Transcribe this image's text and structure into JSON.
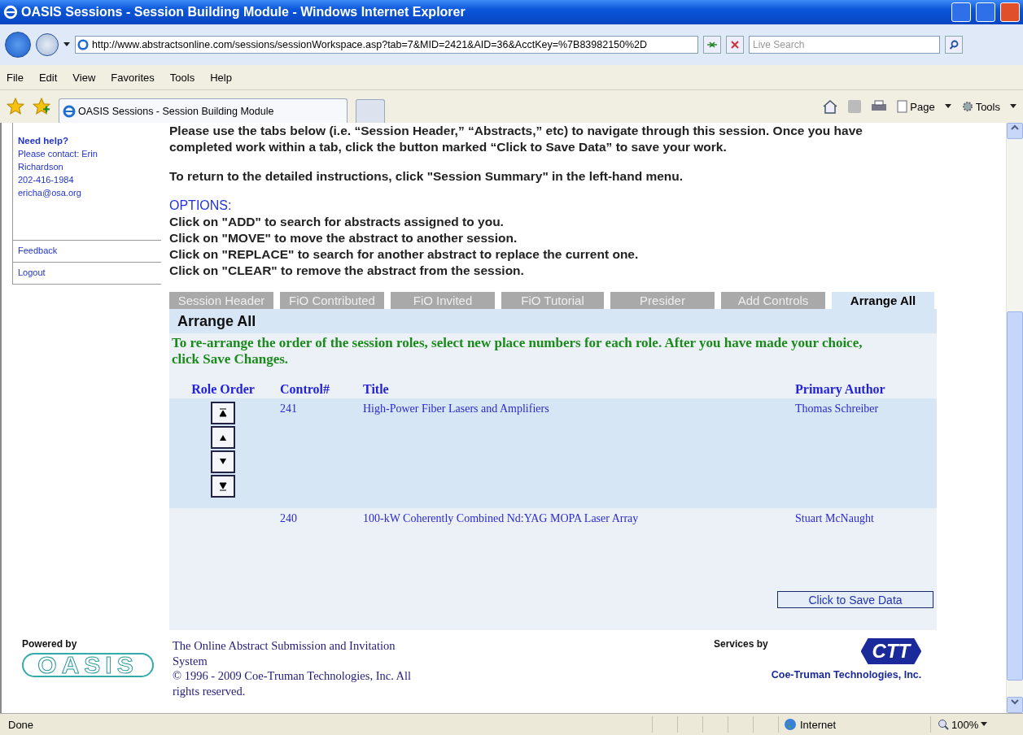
{
  "window": {
    "title": "OASIS Sessions - Session Building Module - Windows Internet Explorer"
  },
  "address_bar": {
    "url": "http://www.abstractsonline.com/sessions/sessionWorkspace.asp?tab=7&MID=2421&AID=36&AcctKey=%7B83982150%2D"
  },
  "search": {
    "placeholder": "Live Search"
  },
  "menu": [
    "File",
    "Edit",
    "View",
    "Favorites",
    "Tools",
    "Help"
  ],
  "browser_tabs": [
    {
      "label": "OASIS Sessions - Session Building Module",
      "selected": true
    }
  ],
  "command_bar": [
    "Page",
    "Tools"
  ],
  "sidebar": {
    "help_title": "Need help?",
    "contact_lines": [
      "Please contact: Erin",
      "Richardson",
      "202-416-1984",
      "ericha@osa.org"
    ],
    "links": [
      "Feedback",
      "Logout"
    ]
  },
  "intro": [
    "Please use the tabs below (i.e. “Session Header,” “Abstracts,” etc) to navigate through this session. Once you have completed work within a tab, click the button marked “Click to Save Data” to save your work.",
    "To return to the detailed instructions, click \"Session Summary\" in the left-hand menu."
  ],
  "options": {
    "heading": "OPTIONS:",
    "lines": [
      "Click on \"ADD\" to search for abstracts assigned to you.",
      "Click on \"MOVE\" to move the abstract to another session.",
      "Click on \"REPLACE\" to search for another abstract to replace the current one.",
      "Click on \"CLEAR\" to remove the abstract from the session."
    ]
  },
  "tabs": [
    {
      "label": "Session Header",
      "selected": false
    },
    {
      "label": "FiO Contributed",
      "selected": false
    },
    {
      "label": "FiO Invited",
      "selected": false
    },
    {
      "label": "FiO Tutorial",
      "selected": false
    },
    {
      "label": "Presider",
      "selected": false
    },
    {
      "label": "Add Controls",
      "selected": false
    },
    {
      "label": "Arrange All",
      "selected": true
    }
  ],
  "panel": {
    "title": "Arrange All",
    "instructions": "To re-arrange the order of the session roles, select new place numbers for each role. After you have made your choice, click Save Changes.",
    "columns": [
      "Role Order",
      "Control#",
      "Title",
      "Primary Author"
    ],
    "rows": [
      {
        "control": "241",
        "title": "High-Power Fiber Lasers and Amplifiers",
        "author": "Thomas Schreiber",
        "selected": true
      },
      {
        "control": "240",
        "title": "100-kW Coherently Combined Nd:YAG MOPA Laser Array",
        "author": "Stuart McNaught",
        "selected": false
      }
    ],
    "save_button": "Click to Save Data"
  },
  "footer": {
    "powered_by": "Powered by",
    "logo": "OASIS",
    "description": "The Online Abstract Submission and Invitation System",
    "copyright": "© 1996 - 2009 Coe-Truman Technologies, Inc. All rights reserved.",
    "services_by": "Services by",
    "ctt_logo": "CTT",
    "company": "Coe-Truman Technologies, Inc."
  },
  "status_bar": {
    "status": "Done",
    "zone": "Internet",
    "zoom": "100%"
  }
}
